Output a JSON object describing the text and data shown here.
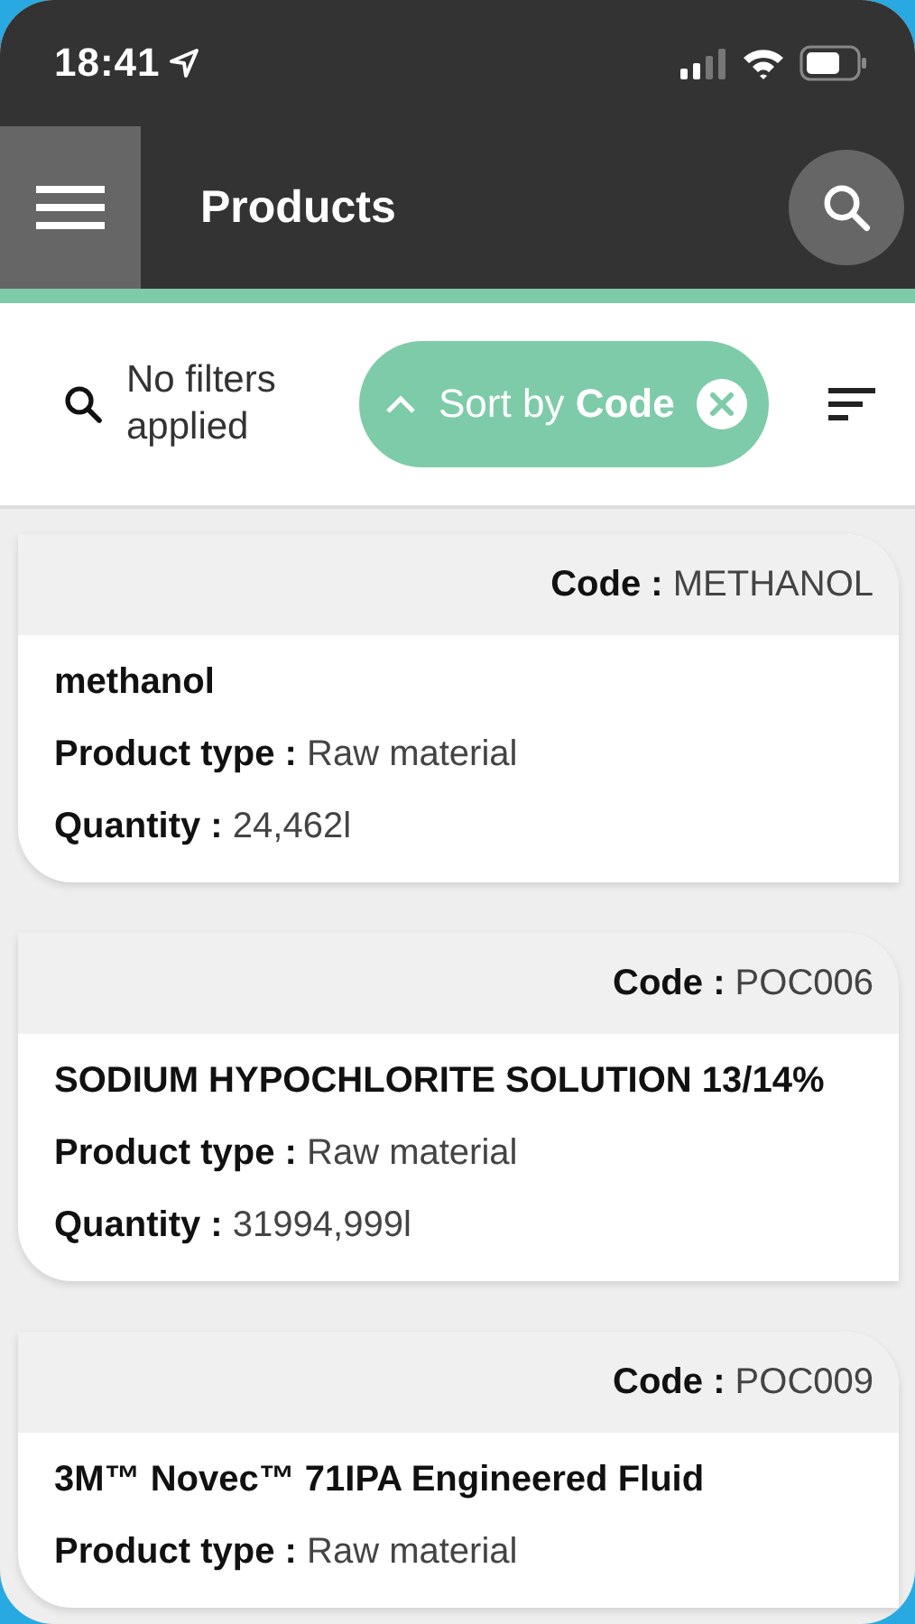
{
  "status_bar": {
    "time": "18:41"
  },
  "app_bar": {
    "title": "Products"
  },
  "filter_bar": {
    "filter_text": "No filters applied",
    "sort": {
      "label": "Sort by",
      "field": "Code",
      "ascending": true
    }
  },
  "products": [
    {
      "code_label": "Code :",
      "code": "METHANOL",
      "name": "methanol",
      "fields": [
        {
          "label": "Product type :",
          "value": "Raw material"
        },
        {
          "label": "Quantity :",
          "value": "24,462l"
        }
      ]
    },
    {
      "code_label": "Code :",
      "code": "POC006",
      "name": "SODIUM HYPOCHLORITE SOLUTION 13/14%",
      "fields": [
        {
          "label": "Product type :",
          "value": "Raw material"
        },
        {
          "label": "Quantity :",
          "value": "31994,999l"
        }
      ]
    },
    {
      "code_label": "Code :",
      "code": "POC009",
      "name": "3M™ Novec™ 71IPA Engineered Fluid",
      "fields": [
        {
          "label": "Product type :",
          "value": "Raw material"
        }
      ]
    }
  ]
}
